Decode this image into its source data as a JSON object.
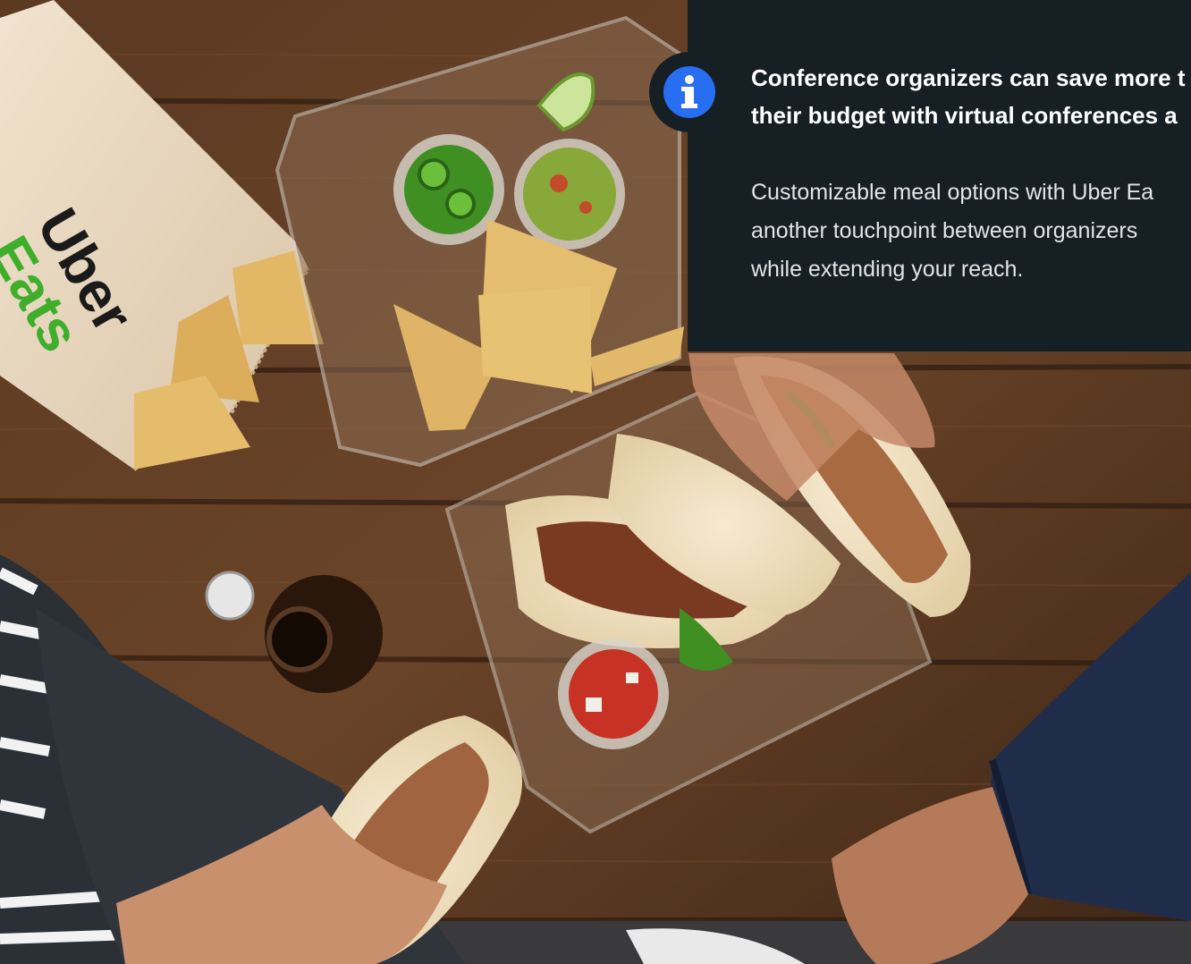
{
  "hero_image": {
    "icon": "uber-eats-tacos-photo",
    "bag_brand_line1": "Uber",
    "bag_brand_line2": "Eats"
  },
  "info_card": {
    "icon": "info-icon",
    "accent_color": "#276ef1",
    "background_color": "#151f24",
    "headline": "Conference organizers can save more t\ntheir budget with virtual conferences a",
    "body": "Customizable meal options with Uber Ea\nanother touchpoint between organizers\nwhile extending your reach."
  }
}
